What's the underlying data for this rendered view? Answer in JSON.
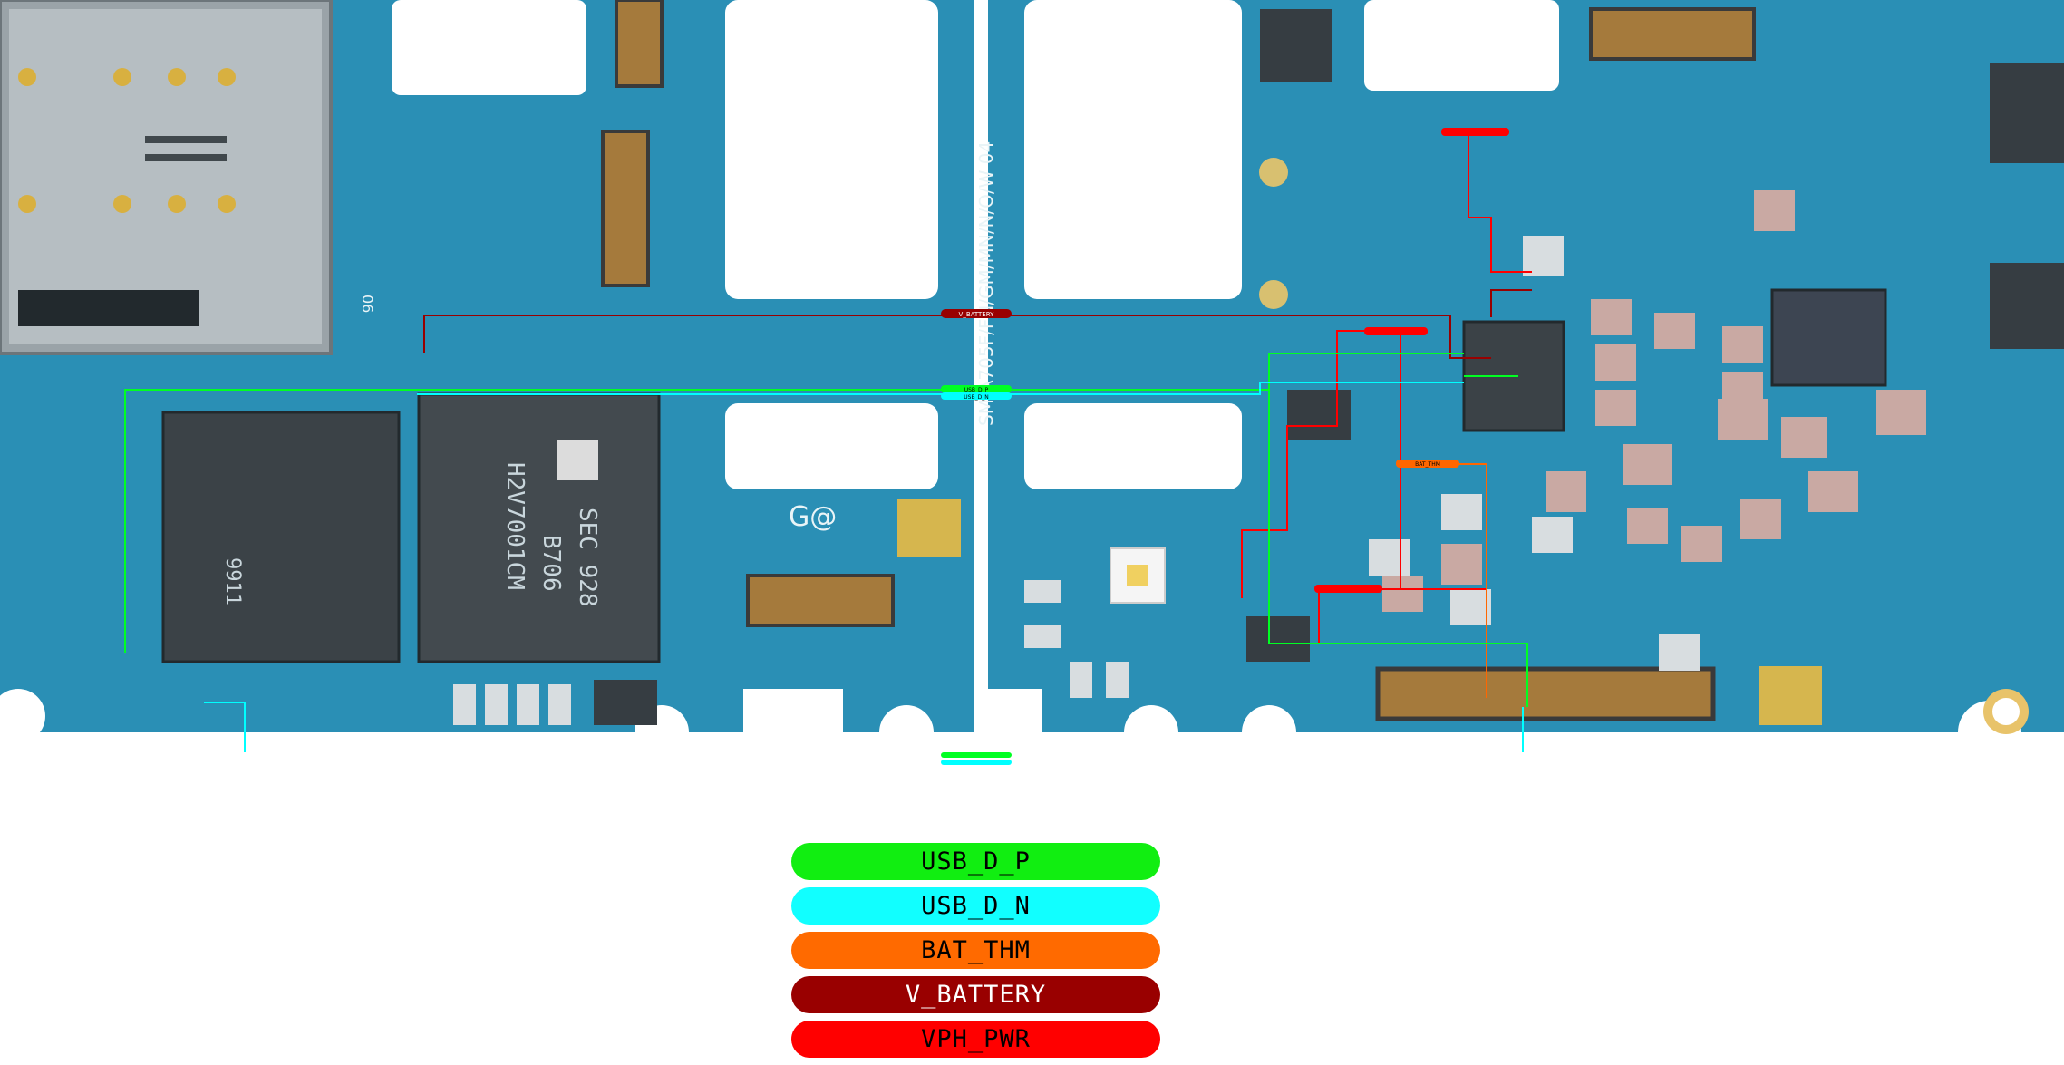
{
  "board": {
    "model_text": "SM-A705F/FN/GM/MN/N/O/W 04",
    "chip_upper_text": "SEC 928",
    "chip_mid_text": "B706",
    "chip_lower_text": "H2V7001CM",
    "soc_text": "9911",
    "logo_text": "G@",
    "rev_text": "06",
    "small_chip_labels": [
      "BAT_THM",
      "V_BATTERY",
      "USB_D_P",
      "USB_D_N"
    ]
  },
  "colors": {
    "board": "#2a8fb5",
    "board_dark": "#1f7597",
    "usb_d_p": "#00ff22",
    "usb_d_n": "#00ffff",
    "bat_thm": "#ff6600",
    "v_battery": "#990000",
    "vph_pwr": "#ff0000"
  },
  "legend": [
    {
      "label": "USB_D_P",
      "color": "#11ee11",
      "text_color": "#000000"
    },
    {
      "label": "USB_D_N",
      "color": "#11ffff",
      "text_color": "#000000"
    },
    {
      "label": "BAT_THM",
      "color": "#ff6a00",
      "text_color": "#000000"
    },
    {
      "label": "V_BATTERY",
      "color": "#990000",
      "text_color": "#ffffff"
    },
    {
      "label": "VPH_PWR",
      "color": "#ff0000",
      "text_color": "#000000"
    }
  ]
}
